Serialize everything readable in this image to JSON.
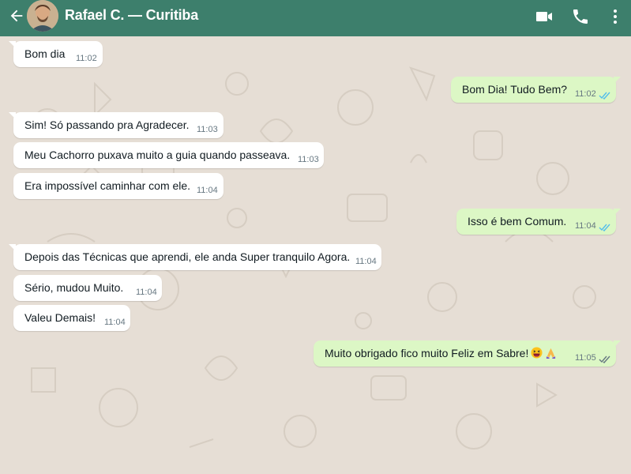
{
  "header": {
    "title": "Rafael C. — Curitiba",
    "icons": [
      "back-arrow-icon",
      "video-call-icon",
      "phone-icon",
      "more-vertical-icon"
    ],
    "color": "#3d7f6c"
  },
  "messages": [
    {
      "dir": "in",
      "text": "Bom dia",
      "time": "11:02"
    },
    {
      "dir": "out",
      "text": "Bom Dia! Tudo Bem?",
      "time": "11:02",
      "status": "read"
    },
    {
      "dir": "in",
      "text": "Sim! Só passando pra Agradecer.",
      "time": "11:03"
    },
    {
      "dir": "in",
      "text": "Meu Cachorro puxava muito a guia quando passeava.",
      "time": "11:03"
    },
    {
      "dir": "in",
      "text": "Era impossível caminhar com ele.",
      "time": "11:04"
    },
    {
      "dir": "out",
      "text": "Isso é bem Comum.",
      "time": "11:04",
      "status": "read"
    },
    {
      "dir": "in",
      "text": "Depois das Técnicas que aprendi, ele anda Super tranquilo Agora.",
      "time": "11:04"
    },
    {
      "dir": "in",
      "text": "Sério, mudou Muito.",
      "time": "11:04"
    },
    {
      "dir": "in",
      "text": "Valeu Demais!",
      "time": "11:04"
    },
    {
      "dir": "out",
      "text": "Muito obrigado fico muito Feliz em Sabre!",
      "time": "11:05",
      "status": "delivered",
      "emojis": [
        "grinning-squinting-face",
        "folded-hands"
      ]
    }
  ],
  "colors": {
    "incoming_bubble": "#ffffff",
    "outgoing_bubble": "#dcf7c5",
    "wallpaper": "#e6ded5",
    "read_ticks": "#53bdeb",
    "delivered_ticks": "#667781"
  }
}
